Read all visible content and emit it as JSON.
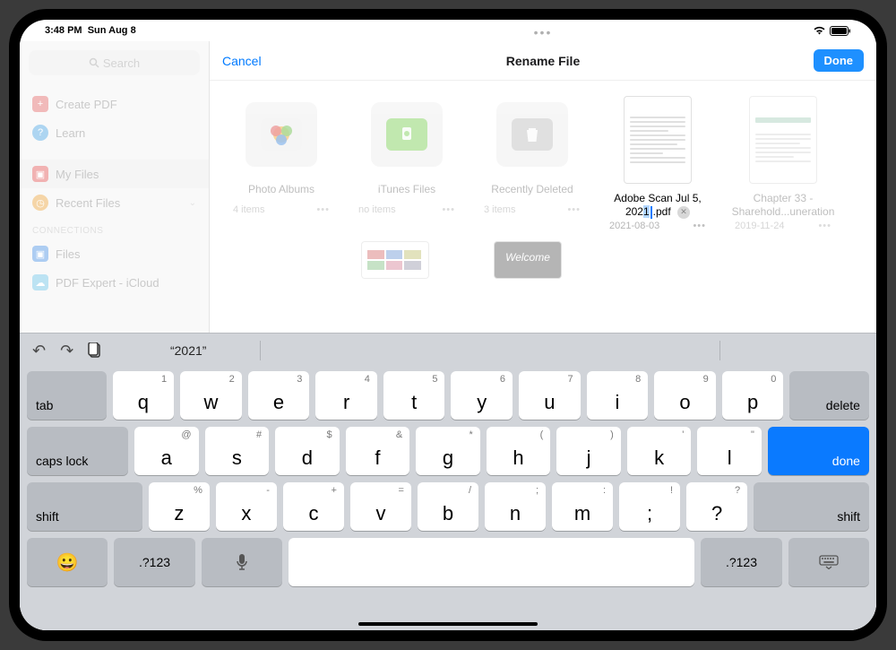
{
  "status": {
    "time": "3:48 PM",
    "date": "Sun Aug 8"
  },
  "sidebar": {
    "search_placeholder": "Search",
    "items": [
      {
        "label": "Create PDF"
      },
      {
        "label": "Learn"
      },
      {
        "label": "My Files"
      },
      {
        "label": "Recent Files"
      }
    ],
    "section": "CONNECTIONS",
    "conn": [
      {
        "label": "Files"
      },
      {
        "label": "PDF Expert - iCloud"
      }
    ]
  },
  "modal": {
    "cancel": "Cancel",
    "title": "Rename File",
    "done": "Done"
  },
  "tiles": {
    "t1": {
      "name": "Photo Albums",
      "meta": "4 items"
    },
    "t2": {
      "name": "iTunes Files",
      "meta": "no items"
    },
    "t3": {
      "name": "Recently Deleted",
      "meta": "3 items"
    },
    "t4": {
      "name_a": "Adobe Scan Jul 5, 202",
      "name_b": ".pdf",
      "meta": "2021-08-03"
    },
    "t5": {
      "name": "Chapter 33 - Sharehold...uneration",
      "meta": "2019-11-24"
    },
    "t7": {
      "name": "Welcome"
    }
  },
  "kb": {
    "suggestion": "“2021”",
    "tab": "tab",
    "delete": "delete",
    "caps": "caps lock",
    "done": "done",
    "shift": "shift",
    "numkey": ".?123",
    "r1": [
      {
        "m": "q",
        "a": "1"
      },
      {
        "m": "w",
        "a": "2"
      },
      {
        "m": "e",
        "a": "3"
      },
      {
        "m": "r",
        "a": "4"
      },
      {
        "m": "t",
        "a": "5"
      },
      {
        "m": "y",
        "a": "6"
      },
      {
        "m": "u",
        "a": "7"
      },
      {
        "m": "i",
        "a": "8"
      },
      {
        "m": "o",
        "a": "9"
      },
      {
        "m": "p",
        "a": "0"
      }
    ],
    "r2": [
      {
        "m": "a",
        "a": "@"
      },
      {
        "m": "s",
        "a": "#"
      },
      {
        "m": "d",
        "a": "$"
      },
      {
        "m": "f",
        "a": "&"
      },
      {
        "m": "g",
        "a": "*"
      },
      {
        "m": "h",
        "a": "("
      },
      {
        "m": "j",
        "a": ")"
      },
      {
        "m": "k",
        "a": "'"
      },
      {
        "m": "l",
        "a": "\""
      }
    ],
    "r3": [
      {
        "m": "z",
        "a": "%"
      },
      {
        "m": "x",
        "a": "-"
      },
      {
        "m": "c",
        "a": "+"
      },
      {
        "m": "v",
        "a": "="
      },
      {
        "m": "b",
        "a": "/"
      },
      {
        "m": "n",
        "a": ";"
      },
      {
        "m": "m",
        "a": ":"
      },
      {
        "m": ";",
        "a": "!"
      },
      {
        "m": "?",
        "a": "?"
      }
    ]
  }
}
